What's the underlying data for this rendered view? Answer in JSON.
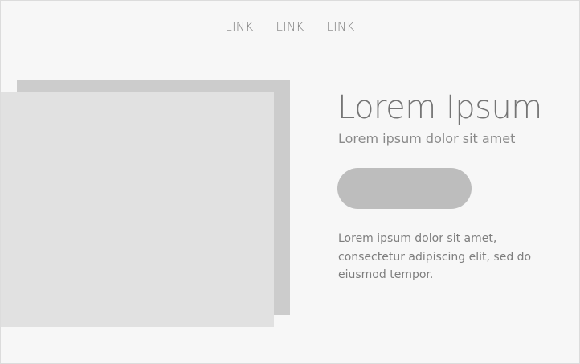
{
  "nav": {
    "links": [
      "LINK",
      "LINK",
      "LINK"
    ]
  },
  "hero": {
    "title": "Lorem Ipsum",
    "subtitle": "Lorem ipsum dolor sit amet",
    "button_label": "",
    "body": "Lorem ipsum dolor sit amet, consectetur adipiscing elit, sed do eiusmod tempor."
  },
  "colors": {
    "background": "#f7f7f7",
    "image_placeholder_back": "#cccccc",
    "image_placeholder_front": "#e1e1e1",
    "button": "#bdbdbd",
    "text": "#757575"
  }
}
